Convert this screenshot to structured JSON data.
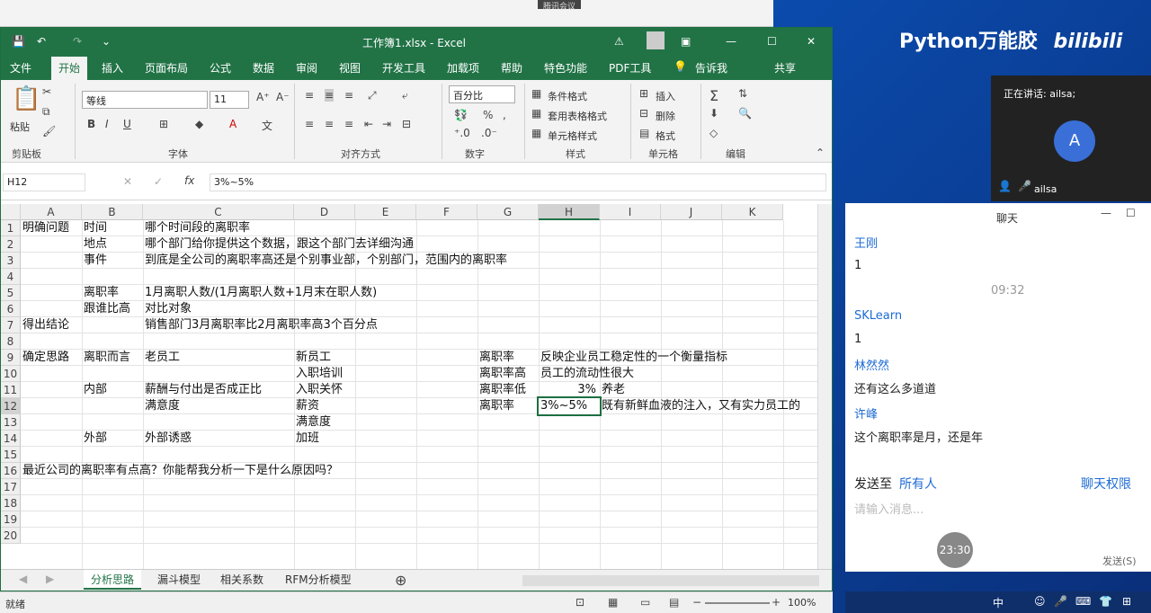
{
  "desktop": {
    "meeting_tab": "腾讯会议"
  },
  "excel": {
    "title": "工作簿1.xlsx  -  Excel",
    "menu": [
      "文件",
      "开始",
      "插入",
      "页面布局",
      "公式",
      "数据",
      "审阅",
      "视图",
      "开发工具",
      "加载项",
      "帮助",
      "特色功能",
      "PDF工具",
      "告诉我",
      "共享"
    ],
    "ribbon": {
      "paste": "粘贴",
      "font_name": "等线",
      "font_size": "11",
      "number_format": "百分比",
      "cond_format": "条件格式",
      "table_format": "套用表格格式",
      "cell_style": "单元格样式",
      "insert": "插入",
      "delete": "删除",
      "format": "格式",
      "groups": [
        "剪贴板",
        "字体",
        "对齐方式",
        "数字",
        "样式",
        "单元格",
        "编辑"
      ]
    },
    "name_box": "H12",
    "formula": "3%~5%",
    "columns": [
      "A",
      "B",
      "C",
      "D",
      "E",
      "F",
      "G",
      "H",
      "I",
      "J",
      "K"
    ],
    "rows": [
      "1",
      "2",
      "3",
      "4",
      "5",
      "6",
      "7",
      "8",
      "9",
      "10",
      "11",
      "12",
      "13",
      "14",
      "15",
      "16",
      "17",
      "18",
      "19",
      "20"
    ],
    "cells": [
      {
        "r": 0,
        "c": 0,
        "v": "明确问题"
      },
      {
        "r": 0,
        "c": 1,
        "v": "时间"
      },
      {
        "r": 0,
        "c": 2,
        "v": "哪个时间段的离职率"
      },
      {
        "r": 1,
        "c": 1,
        "v": "地点"
      },
      {
        "r": 1,
        "c": 2,
        "v": "哪个部门给你提供这个数据，跟这个部门去详细沟通"
      },
      {
        "r": 2,
        "c": 1,
        "v": "事件"
      },
      {
        "r": 2,
        "c": 2,
        "v": "到底是全公司的离职率高还是个别事业部，个别部门，范围内的离职率"
      },
      {
        "r": 4,
        "c": 1,
        "v": "离职率"
      },
      {
        "r": 4,
        "c": 2,
        "v": "1月离职人数/(1月离职人数+1月末在职人数)"
      },
      {
        "r": 5,
        "c": 1,
        "v": "跟谁比高"
      },
      {
        "r": 5,
        "c": 2,
        "v": "对比对象"
      },
      {
        "r": 6,
        "c": 0,
        "v": "得出结论"
      },
      {
        "r": 6,
        "c": 2,
        "v": "销售部门3月离职率比2月离职率高3个百分点"
      },
      {
        "r": 8,
        "c": 0,
        "v": "确定思路"
      },
      {
        "r": 8,
        "c": 1,
        "v": "离职而言"
      },
      {
        "r": 8,
        "c": 2,
        "v": "老员工"
      },
      {
        "r": 8,
        "c": 3,
        "v": "新员工"
      },
      {
        "r": 8,
        "c": 6,
        "v": "离职率"
      },
      {
        "r": 8,
        "c": 7,
        "v": "反映企业员工稳定性的一个衡量指标"
      },
      {
        "r": 9,
        "c": 3,
        "v": "入职培训"
      },
      {
        "r": 9,
        "c": 6,
        "v": "离职率高"
      },
      {
        "r": 9,
        "c": 7,
        "v": "员工的流动性很大"
      },
      {
        "r": 10,
        "c": 1,
        "v": "内部"
      },
      {
        "r": 10,
        "c": 2,
        "v": "薪酬与付出是否成正比"
      },
      {
        "r": 10,
        "c": 3,
        "v": "入职关怀"
      },
      {
        "r": 10,
        "c": 6,
        "v": "离职率低"
      },
      {
        "r": 10,
        "c": 7,
        "v": "3%",
        "align": "right"
      },
      {
        "r": 10,
        "c": 8,
        "v": "养老"
      },
      {
        "r": 11,
        "c": 2,
        "v": "满意度"
      },
      {
        "r": 11,
        "c": 3,
        "v": "薪资"
      },
      {
        "r": 11,
        "c": 6,
        "v": "离职率"
      },
      {
        "r": 11,
        "c": 7,
        "v": "3%~5%"
      },
      {
        "r": 11,
        "c": 8,
        "v": "既有新鲜血液的注入，又有实力员工的"
      },
      {
        "r": 12,
        "c": 3,
        "v": "满意度"
      },
      {
        "r": 13,
        "c": 1,
        "v": "外部"
      },
      {
        "r": 13,
        "c": 2,
        "v": "外部诱惑"
      },
      {
        "r": 13,
        "c": 3,
        "v": "加班"
      },
      {
        "r": 15,
        "c": 0,
        "v": "最近公司的离职率有点高？你能帮我分析一下是什么原因吗？"
      }
    ],
    "sheets": [
      "分析思路",
      "漏斗模型",
      "相关系数",
      "RFM分析模型"
    ],
    "status": "就绪",
    "zoom": "100%"
  },
  "brand": "Python万能胶",
  "brand_logo": "bilibili",
  "meeting": {
    "speaking": "正在讲话: ailsa;",
    "avatar_letter": "A",
    "participant": "ailsa"
  },
  "chat": {
    "title": "聊天",
    "messages": [
      {
        "name": "王刚",
        "text": "1"
      },
      {
        "time": "09:32"
      },
      {
        "name": "SKLearn",
        "text": "1"
      },
      {
        "name": "林然然",
        "text": "还有这么多道道"
      },
      {
        "name": "许峰",
        "text": "这个离职率是月，还是年"
      }
    ],
    "send_to_label": "发送至",
    "send_to_value": "所有人",
    "permission": "聊天权限",
    "input_placeholder": "请输入消息...",
    "send_button": "发送(S)",
    "timer": "23:30"
  },
  "taskbar": {
    "ime": "中"
  }
}
